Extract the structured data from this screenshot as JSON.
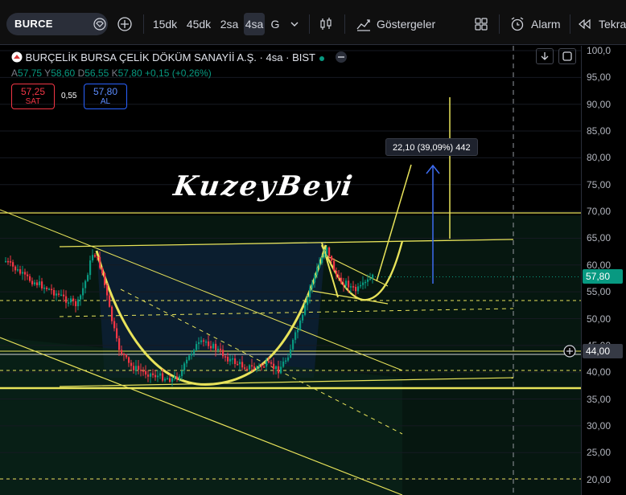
{
  "toolbar": {
    "symbol": "BURCE",
    "intervals": [
      "15dk",
      "45dk",
      "2sa",
      "4sa",
      "G"
    ],
    "active_interval": "4sa",
    "indicators_label": "Göstergeler",
    "alarm_label": "Alarm",
    "replay_label": "Tekra"
  },
  "legend": {
    "title": "BURÇELİK BURSA ÇELİK DÖKÜM SANAYİİ A.Ş.",
    "interval": "4sa",
    "exchange": "BIST",
    "sep": "·"
  },
  "ohlc": {
    "open_label": "A",
    "open": "57,75",
    "high_label": "Y",
    "high": "58,60",
    "low_label": "D",
    "low": "56,55",
    "close_label": "K",
    "close": "57,80",
    "change": "+0,15 (+0,26%)"
  },
  "trade": {
    "sell_price": "57,25",
    "sell_label": "SAT",
    "spread": "0,55",
    "buy_price": "57,80",
    "buy_label": "AL"
  },
  "watermark": "KuzeyBeyi",
  "measure_label": "22,10 (39,09%) 442",
  "axis": {
    "ticks": [
      "100,0",
      "95,00",
      "90,00",
      "85,00",
      "80,00",
      "75,00",
      "70,00",
      "65,00",
      "60,00",
      "55,00",
      "50,00",
      "45,00",
      "40,00",
      "35,00",
      "30,00",
      "25,00",
      "20,00"
    ],
    "tick_values": [
      100,
      95,
      90,
      85,
      80,
      75,
      70,
      65,
      60,
      55,
      50,
      45,
      40,
      35,
      30,
      25,
      20
    ],
    "last_price": "57,80",
    "last_price_value": 57.8,
    "crosshair_price": "44,00",
    "crosshair_value": 44.0,
    "last_price_color": "#089981",
    "crosshair_color": "#363a45"
  },
  "colors": {
    "up": "#089981",
    "down": "#f23645",
    "drawing": "#e8e35a",
    "arrow": "#3d6cf0"
  }
}
